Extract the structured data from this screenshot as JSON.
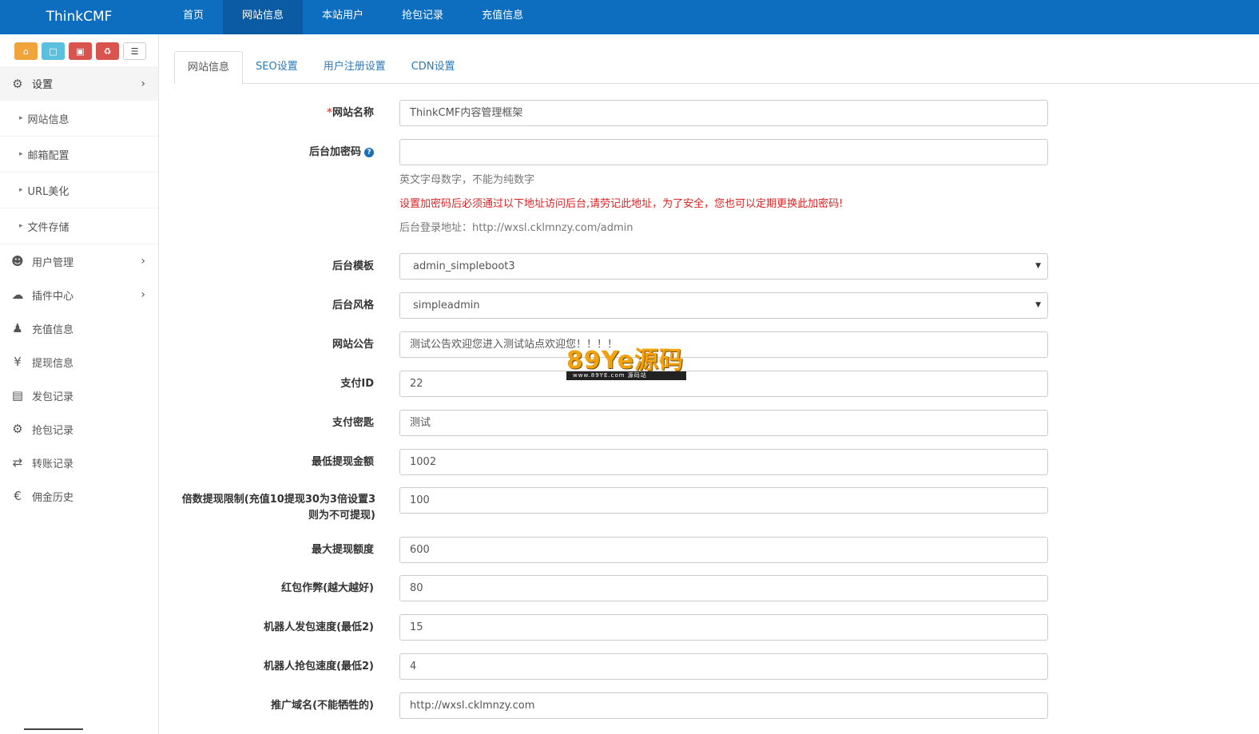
{
  "navbar": {
    "brand": "ThinkCMF",
    "items": [
      {
        "label": "首页",
        "active": false
      },
      {
        "label": "网站信息",
        "active": true
      },
      {
        "label": "本站用户",
        "active": false
      },
      {
        "label": "抢包记录",
        "active": false
      },
      {
        "label": "充值信息",
        "active": false
      }
    ]
  },
  "sidebar": {
    "menu": {
      "settings": "设置",
      "settings_sub": [
        "网站信息",
        "邮箱配置",
        "URL美化",
        "文件存储"
      ],
      "user_mgmt": "用户管理",
      "plugins": "插件中心",
      "recharge": "充值信息",
      "withdraw": "提现信息",
      "send_records": "发包记录",
      "grab_records": "抢包记录",
      "transfer_records": "转账记录",
      "commission": "佣金历史"
    }
  },
  "tabs": [
    "网站信息",
    "SEO设置",
    "用户注册设置",
    "CDN设置"
  ],
  "form": {
    "site_name": {
      "label": "网站名称",
      "required_mark": "*",
      "value": "ThinkCMF内容管理框架"
    },
    "admin_password": {
      "label": "后台加密码",
      "value": "",
      "help1": "英文字母数字，不能为纯数字",
      "help2": "设置加密码后必须通过以下地址访问后台,请劳记此地址，为了安全，您也可以定期更换此加密码!",
      "help3": "后台登录地址：http://wxsl.cklmnzy.com/admin"
    },
    "admin_template": {
      "label": "后台模板",
      "value": "admin_simpleboot3"
    },
    "admin_style": {
      "label": "后台风格",
      "value": "simpleadmin"
    },
    "notice": {
      "label": "网站公告",
      "value": "测试公告欢迎您进入测试站点欢迎您！！！！"
    },
    "pay_id": {
      "label": "支付ID",
      "value": "22"
    },
    "pay_key": {
      "label": "支付密匙",
      "value": "测试"
    },
    "min_withdraw": {
      "label": "最低提现金额",
      "value": "1002"
    },
    "multiple_limit": {
      "label_line1": "倍数提现限制(充值10提现30为3倍设置3",
      "label_line2": "则为不可提现)",
      "value": "100"
    },
    "max_withdraw": {
      "label": "最大提现额度",
      "value": "600"
    },
    "cheat": {
      "label": "红包作弊(越大越好)",
      "value": "80"
    },
    "robot_send": {
      "label": "机器人发包速度(最低2)",
      "value": "15"
    },
    "robot_grab": {
      "label": "机器人抢包速度(最低2)",
      "value": "4"
    },
    "promo_domain": {
      "label": "推广域名(不能牺牲的)",
      "value": "http://wxsl.cklmnzy.com"
    }
  },
  "watermark": {
    "main": "89Ye源码",
    "sub": "www.89YE.com  源码站"
  }
}
